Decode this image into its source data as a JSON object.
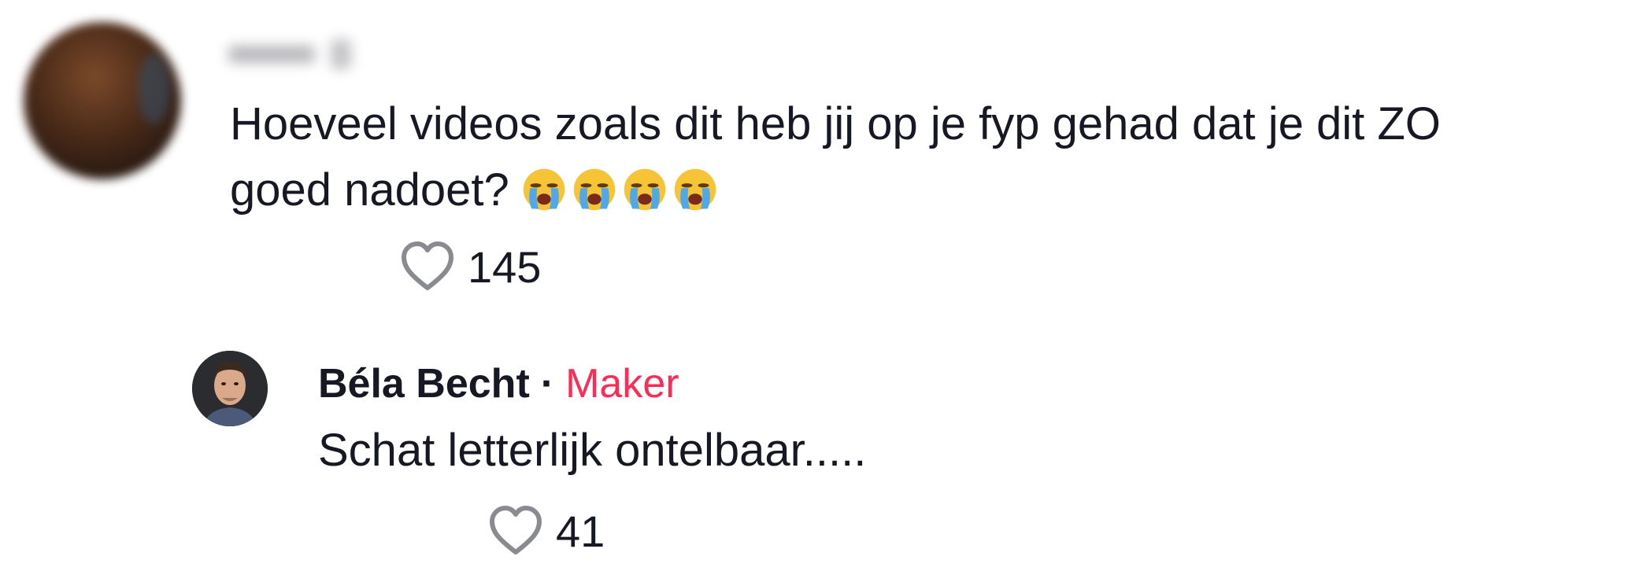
{
  "comment": {
    "username": "",
    "line1": "Hoeveel videos zoals dit heb jij op je fyp gehad dat je dit ZO",
    "line2": "goed nadoet?",
    "emojis": [
      "crying-face-emoji",
      "crying-face-emoji",
      "crying-face-emoji",
      "crying-face-emoji"
    ],
    "likes": "145"
  },
  "reply": {
    "author": "Béla Becht",
    "separator": "·",
    "badge": "Maker",
    "text": "Schat letterlijk ontelbaar.....",
    "likes": "41"
  },
  "colors": {
    "text": "#161823",
    "badge": "#fe2c55",
    "heart_outline": "#8a8b91"
  }
}
